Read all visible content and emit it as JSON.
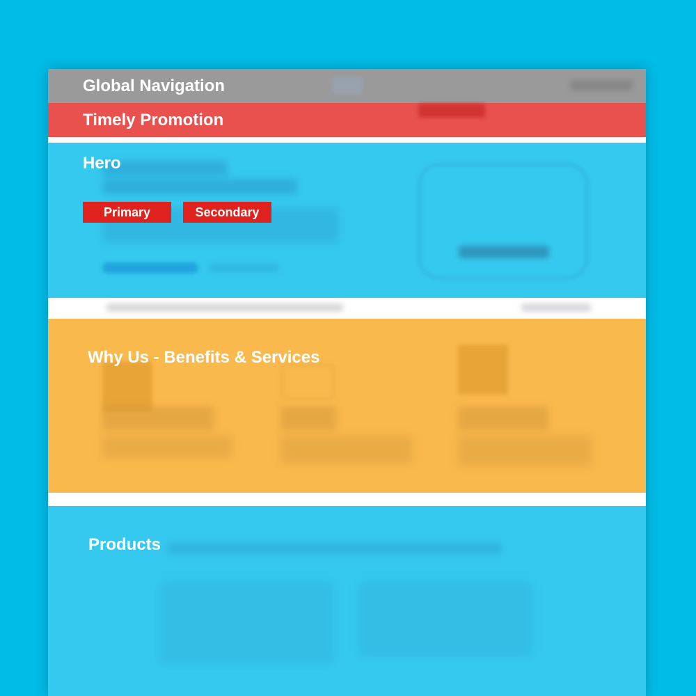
{
  "colors": {
    "background": "#00bde8",
    "global_navigation": "#9a9a9a",
    "timely_promotion": "#e8514e",
    "hero": "#36c9ef",
    "why_us": "#fab94d",
    "products": "#36c9ef",
    "button": "#e0221f"
  },
  "sections": {
    "global_navigation": "Global Navigation",
    "timely_promotion": "Timely Promotion",
    "hero": "Hero",
    "why_us": "Why Us - Benefits & Services",
    "products": "Products"
  },
  "hero_buttons": {
    "primary": "Primary",
    "secondary": "Secondary"
  }
}
